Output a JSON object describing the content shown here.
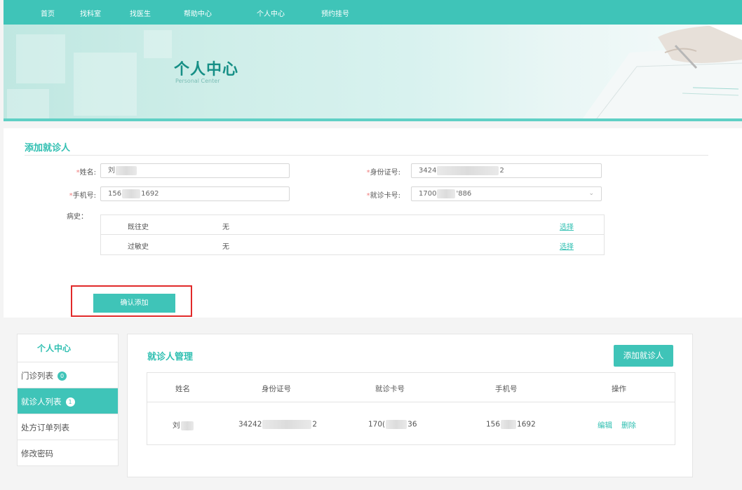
{
  "nav": {
    "items": [
      "首页",
      "找科室",
      "找医生",
      "帮助中心",
      "个人中心",
      "预约挂号"
    ]
  },
  "banner": {
    "title": "个人中心",
    "subtitle": "Personal Center"
  },
  "add_form": {
    "title": "添加就诊人",
    "name_label": "姓名:",
    "name_value": "刘",
    "id_label": "身份证号:",
    "id_value_start": "3424",
    "id_value_end": "2",
    "phone_label": "手机号:",
    "phone_value_start": "156",
    "phone_value_end": "1692",
    "card_label": "就诊卡号:",
    "card_value_start": "1700",
    "card_value_end": "'886",
    "history_label": "病史：",
    "history_rows": [
      {
        "name": "既往史",
        "value": "无",
        "action": "选择"
      },
      {
        "name": "过敏史",
        "value": "无",
        "action": "选择"
      }
    ],
    "confirm_label": "确认添加"
  },
  "sidebar": {
    "title": "个人中心",
    "items": [
      {
        "label": "门诊列表",
        "badge": "0"
      },
      {
        "label": "就诊人列表",
        "badge": "1"
      },
      {
        "label": "处方订单列表"
      },
      {
        "label": "修改密码"
      }
    ]
  },
  "patients": {
    "title": "就诊人管理",
    "add_button": "添加就诊人",
    "columns": [
      "姓名",
      "身份证号",
      "就诊卡号",
      "手机号",
      "操作"
    ],
    "rows": [
      {
        "name": "刘",
        "id_start": "34242",
        "id_end": "2",
        "card_start": "170(",
        "card_end": "36",
        "phone_start": "156",
        "phone_end": "1692",
        "edit": "编辑",
        "delete": "删除"
      }
    ]
  },
  "colors": {
    "accent": "#3fc4b8",
    "highlight_border": "#e12a2a"
  }
}
